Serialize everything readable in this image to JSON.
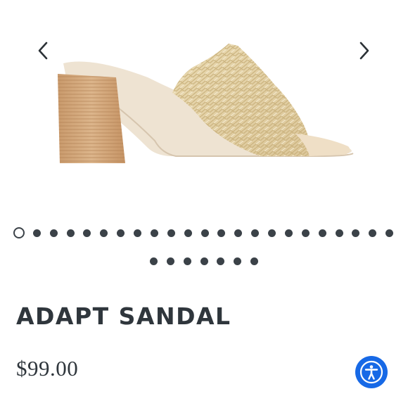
{
  "gallery": {
    "prev_icon": "chevron-left-icon",
    "next_icon": "chevron-right-icon",
    "image_alt": "Woven raffia slide sandal with stacked block heel",
    "dots_total": 30,
    "active_index": 0
  },
  "product": {
    "title": "ADAPT SANDAL",
    "price": "$99.00"
  },
  "accessibility": {
    "icon": "accessibility-icon",
    "color": "#1769e6"
  }
}
